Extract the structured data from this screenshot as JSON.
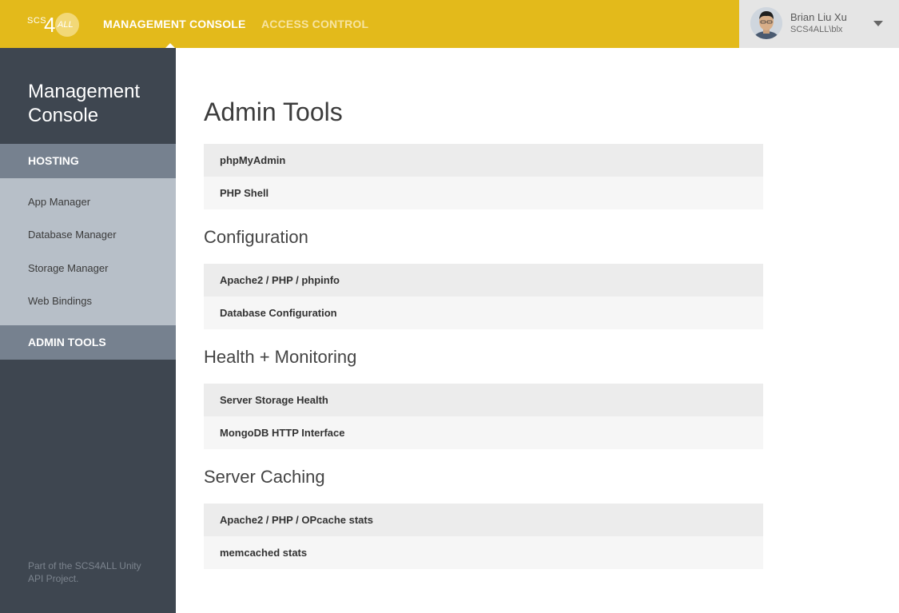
{
  "header": {
    "logo": {
      "scs": "SCS",
      "four": "4",
      "all": "ALL"
    },
    "nav": [
      {
        "label": "MANAGEMENT CONSOLE"
      },
      {
        "label": "ACCESS CONTROL"
      }
    ],
    "user": {
      "name": "Brian Liu Xu",
      "login": "SCS4ALL\\blx"
    },
    "colors": {
      "bar": "#e3ba1b",
      "active": "#ffffff",
      "inactive": "#f7e4a2"
    }
  },
  "sidebar": {
    "title": "Management Console",
    "sections": [
      {
        "label": "HOSTING",
        "items": [
          {
            "label": "App Manager"
          },
          {
            "label": "Database Manager"
          },
          {
            "label": "Storage Manager"
          },
          {
            "label": "Web Bindings"
          }
        ]
      },
      {
        "label": "ADMIN TOOLS",
        "items": []
      }
    ],
    "footer": "Part of the SCS4ALL Unity API Project."
  },
  "main": {
    "title": "Admin Tools",
    "top_items": [
      {
        "label": "phpMyAdmin"
      },
      {
        "label": "PHP Shell"
      }
    ],
    "sections": [
      {
        "title": "Configuration",
        "items": [
          {
            "label": "Apache2 / PHP / phpinfo"
          },
          {
            "label": "Database Configuration"
          }
        ]
      },
      {
        "title": "Health + Monitoring",
        "items": [
          {
            "label": "Server Storage Health"
          },
          {
            "label": "MongoDB HTTP Interface"
          }
        ]
      },
      {
        "title": "Server Caching",
        "items": [
          {
            "label": "Apache2 / PHP / OPcache stats"
          },
          {
            "label": "memcached stats"
          }
        ]
      }
    ]
  }
}
